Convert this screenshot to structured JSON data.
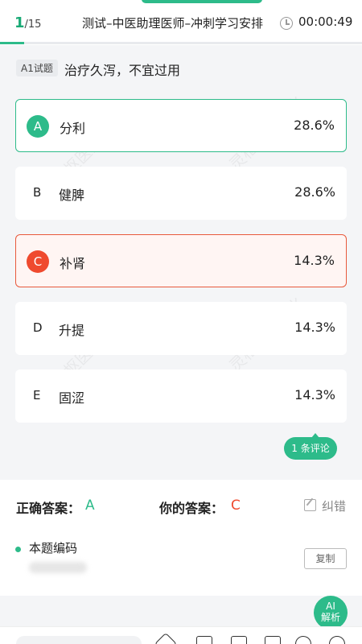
{
  "header": {
    "progress_current": "1",
    "progress_total": "/15",
    "progress_fraction": 0.0667,
    "title": "测试–中医助理医师–冲刺学习安排",
    "timer": "00:00:49"
  },
  "question": {
    "type_label": "A1试题",
    "text": "治疗久泻，不宜过用"
  },
  "options": [
    {
      "letter": "A",
      "text": "分利",
      "percent": "28.6%",
      "state": "correct"
    },
    {
      "letter": "B",
      "text": "健脾",
      "percent": "28.6%",
      "state": "normal"
    },
    {
      "letter": "C",
      "text": "补肾",
      "percent": "14.3%",
      "state": "wrong"
    },
    {
      "letter": "D",
      "text": "升提",
      "percent": "14.3%",
      "state": "normal"
    },
    {
      "letter": "E",
      "text": "固涩",
      "percent": "14.3%",
      "state": "normal"
    }
  ],
  "comment_button": "1 条评论",
  "answer": {
    "correct_label": "正确答案：",
    "correct_value": "A",
    "yours_label": "你的答案：",
    "yours_value": "C",
    "fix_label": "纠错",
    "code_label": "本题编码",
    "copy_label": "复制"
  },
  "ai_button": {
    "line1": "AI",
    "line2": "解析"
  },
  "watermark": "灵枢医药文化",
  "colors": {
    "accent": "#2dbb8a",
    "error": "#ef4a2e"
  }
}
